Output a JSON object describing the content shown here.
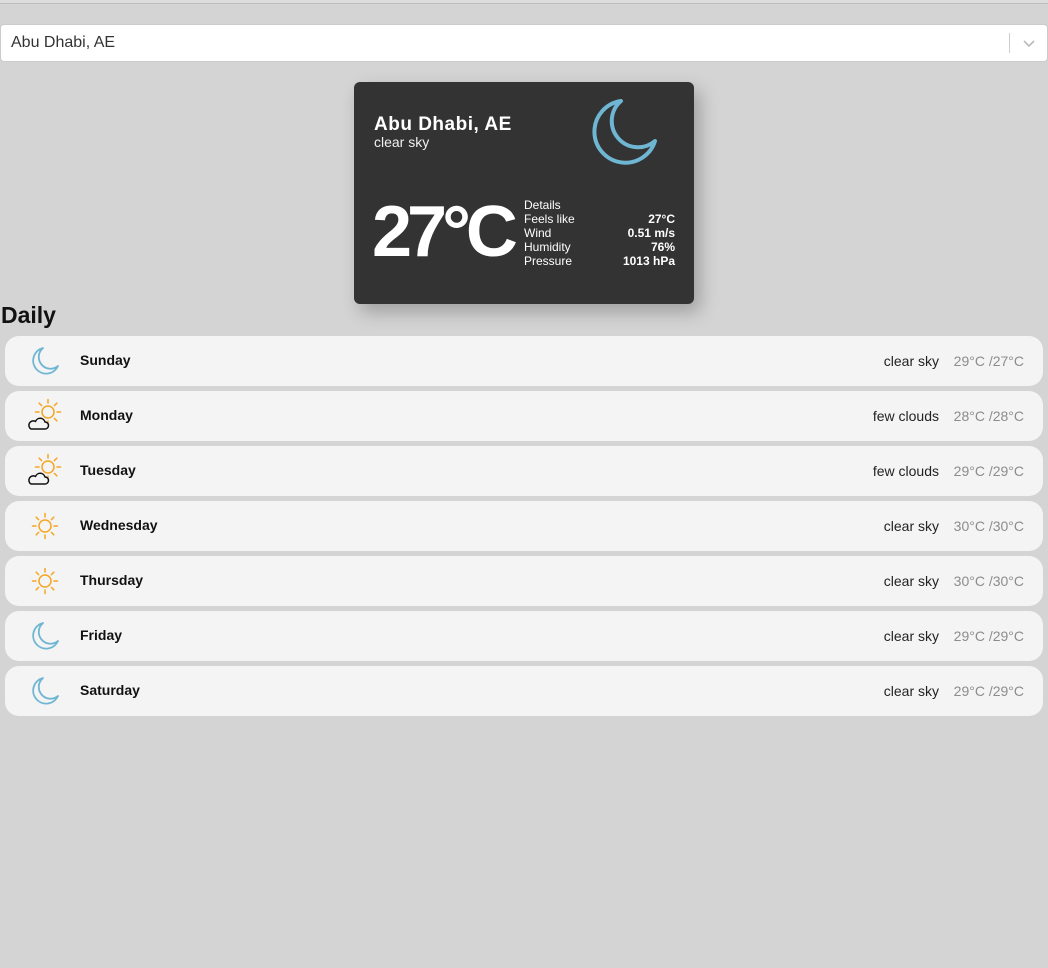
{
  "search": {
    "selected_value": "Abu Dhabi, AE"
  },
  "current": {
    "city": "Abu Dhabi, AE",
    "description": "clear sky",
    "icon": "moon-icon",
    "temperature": "27°C",
    "details_label": "Details",
    "details": [
      {
        "label": "Feels like",
        "value": "27°C"
      },
      {
        "label": "Wind",
        "value": "0.51 m/s"
      },
      {
        "label": "Humidity",
        "value": "76%"
      },
      {
        "label": "Pressure",
        "value": "1013 hPa"
      }
    ]
  },
  "daily": {
    "title": "Daily",
    "days": [
      {
        "name": "Sunday",
        "description": "clear sky",
        "temps": "29°C /27°C",
        "icon": "moon-icon"
      },
      {
        "name": "Monday",
        "description": "few clouds",
        "temps": "28°C /28°C",
        "icon": "sun-cloud-icon"
      },
      {
        "name": "Tuesday",
        "description": "few clouds",
        "temps": "29°C /29°C",
        "icon": "sun-cloud-icon"
      },
      {
        "name": "Wednesday",
        "description": "clear sky",
        "temps": "30°C /30°C",
        "icon": "sun-icon"
      },
      {
        "name": "Thursday",
        "description": "clear sky",
        "temps": "30°C /30°C",
        "icon": "sun-icon"
      },
      {
        "name": "Friday",
        "description": "clear sky",
        "temps": "29°C /29°C",
        "icon": "moon-icon"
      },
      {
        "name": "Saturday",
        "description": "clear sky",
        "temps": "29°C /29°C",
        "icon": "moon-icon"
      }
    ]
  },
  "colors": {
    "background": "#d4d4d4",
    "card": "#333333",
    "moon": "#6fb6d3",
    "sun": "#f5a623",
    "row": "#f4f4f4"
  }
}
